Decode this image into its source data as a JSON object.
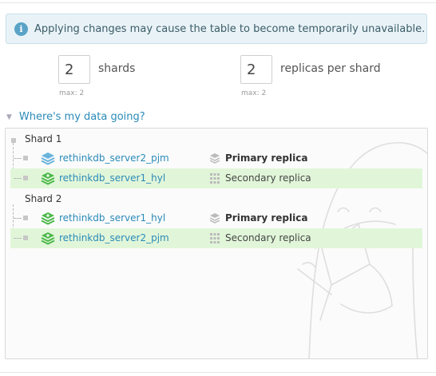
{
  "alert": {
    "icon": "info-icon",
    "text": "Applying changes may cause the table to become temporarily unavailable."
  },
  "config": {
    "shards": {
      "value": "2",
      "label": "shards",
      "max_note": "max: 2"
    },
    "replicas": {
      "value": "2",
      "label": "replicas per shard",
      "max_note": "max: 2"
    }
  },
  "toggle": {
    "label": "Where's my data going?",
    "icon": "caret-down-icon"
  },
  "shards": [
    {
      "title": "Shard 1",
      "replicas": [
        {
          "server": "rethinkdb_server2_pjm",
          "role": "Primary replica",
          "type": "primary",
          "server_icon": "server-layers-icon-blue",
          "role_icon": "primary-layers-icon"
        },
        {
          "server": "rethinkdb_server1_hyl",
          "role": "Secondary replica",
          "type": "secondary",
          "server_icon": "server-layers-icon-green",
          "role_icon": "secondary-grid-icon"
        }
      ]
    },
    {
      "title": "Shard 2",
      "replicas": [
        {
          "server": "rethinkdb_server1_hyl",
          "role": "Primary replica",
          "type": "primary",
          "server_icon": "server-layers-icon-green",
          "role_icon": "primary-layers-icon"
        },
        {
          "server": "rethinkdb_server2_pjm",
          "role": "Secondary replica",
          "type": "secondary",
          "server_icon": "server-layers-icon-green",
          "role_icon": "secondary-grid-icon"
        }
      ]
    }
  ],
  "colors": {
    "link": "#2a8ab8",
    "secondary_row_bg": "#e1f6d9",
    "server_blue": "#6ab4dc",
    "server_green": "#4db84a",
    "alert_bg": "#e9f3f7"
  }
}
